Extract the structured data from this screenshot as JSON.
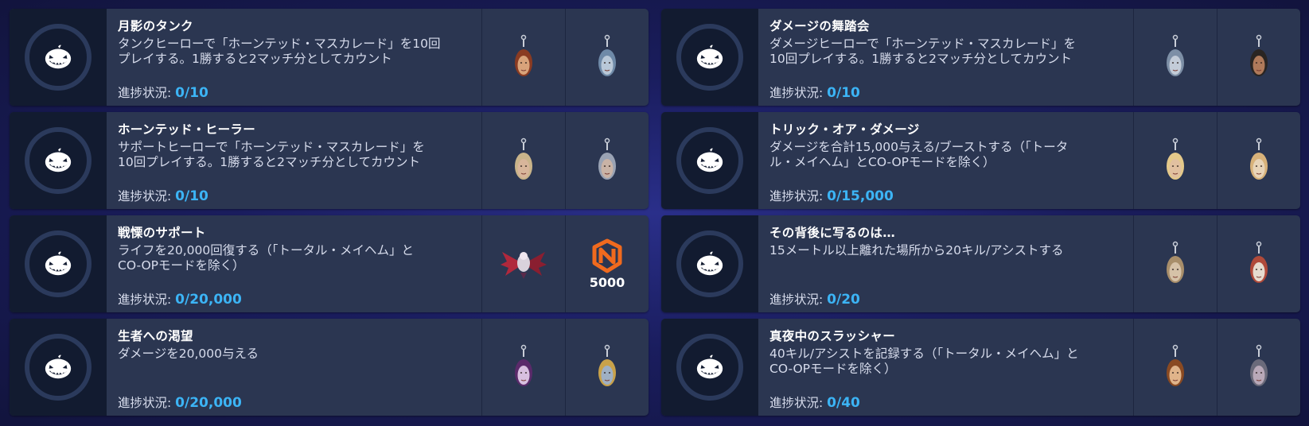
{
  "challenges": [
    {
      "title": "月影のタンク",
      "desc_lines": [
        "タンクヒーローで「ホーンテッド・マスカレード」を10回",
        "プレイする。1勝すると2マッチ分としてカウント"
      ],
      "progress_label": "進捗状況:",
      "current": "0",
      "total": "10",
      "rewards": [
        {
          "type": "charm",
          "icon": "charm-icon",
          "hair": "#8a3b22",
          "face": "#d9a37a"
        },
        {
          "type": "charm",
          "icon": "charm-icon",
          "hair": "#6f8aa8",
          "face": "#b9c8d8"
        }
      ]
    },
    {
      "title": "ダメージの舞踏会",
      "desc_lines": [
        "ダメージヒーローで「ホーンテッド・マスカレード」を",
        "10回プレイする。1勝すると2マッチ分としてカウント"
      ],
      "progress_label": "進捗状況:",
      "current": "0",
      "total": "10",
      "rewards": [
        {
          "type": "charm",
          "icon": "charm-icon",
          "hair": "#7d8fa6",
          "face": "#c3ccd8"
        },
        {
          "type": "charm",
          "icon": "charm-icon",
          "hair": "#2a2522",
          "face": "#b07a5a"
        }
      ]
    },
    {
      "title": "ホーンテッド・ヒーラー",
      "desc_lines": [
        "サポートヒーローで「ホーンテッド・マスカレード」を",
        "10回プレイする。1勝すると2マッチ分としてカウント"
      ],
      "progress_label": "進捗状況:",
      "current": "0",
      "total": "10",
      "rewards": [
        {
          "type": "charm",
          "icon": "charm-icon",
          "hair": "#c9b48a",
          "face": "#d8b59a"
        },
        {
          "type": "charm",
          "icon": "charm-icon",
          "hair": "#9aa3b4",
          "face": "#c9b3a6"
        }
      ]
    },
    {
      "title": "トリック・オア・ダメージ",
      "desc_lines": [
        "ダメージを合計15,000与える/ブーストする（「トータ",
        "ル・メイヘム」とCO-OPモードを除く）"
      ],
      "progress_label": "進捗状況:",
      "current": "0",
      "total": "15,000",
      "rewards": [
        {
          "type": "charm",
          "icon": "charm-icon",
          "hair": "#e4c98a",
          "face": "#e1c0a0"
        },
        {
          "type": "charm",
          "icon": "charm-icon",
          "hair": "#d8b27a",
          "face": "#e8d4b8"
        }
      ]
    },
    {
      "title": "戦慄のサポート",
      "desc_lines": [
        "ライフを20,000回復する（「トータル・メイヘム」と",
        "CO-OPモードを除く）"
      ],
      "progress_label": "進捗状況:",
      "current": "0",
      "total": "20,000",
      "rewards": [
        {
          "type": "spray",
          "icon": "winged-spray-icon"
        },
        {
          "type": "currency",
          "icon": "currency-badge-icon",
          "value": "5000",
          "color": "#f06a1e"
        }
      ]
    },
    {
      "title": "その背後に写るのは…",
      "desc_lines": [
        "15メートル以上離れた場所から20キル/アシストする"
      ],
      "progress_label": "進捗状況:",
      "current": "0",
      "total": "20",
      "rewards": [
        {
          "type": "charm",
          "icon": "charm-icon",
          "hair": "#a88e6a",
          "face": "#d6c2a8"
        },
        {
          "type": "charm",
          "icon": "charm-icon",
          "hair": "#b04a3a",
          "face": "#e6dccf"
        }
      ]
    },
    {
      "title": "生者への渇望",
      "desc_lines": [
        "ダメージを20,000与える"
      ],
      "progress_label": "進捗状況:",
      "current": "0",
      "total": "20,000",
      "rewards": [
        {
          "type": "charm",
          "icon": "charm-icon",
          "hair": "#5a2a6a",
          "face": "#d8c0e0"
        },
        {
          "type": "charm",
          "icon": "charm-icon",
          "hair": "#c9a24a",
          "face": "#9fb0c4"
        }
      ]
    },
    {
      "title": "真夜中のスラッシャー",
      "desc_lines": [
        "40キル/アシストを記録する（「トータル・メイヘム」と",
        "CO-OPモードを除く）"
      ],
      "progress_label": "進捗状況:",
      "current": "0",
      "total": "40",
      "rewards": [
        {
          "type": "charm",
          "icon": "charm-icon",
          "hair": "#8a4a22",
          "face": "#e0b48a"
        },
        {
          "type": "charm",
          "icon": "charm-icon",
          "hair": "#6a6a7a",
          "face": "#b8a8b8"
        }
      ]
    }
  ],
  "colors": {
    "progress": "#3cb4f5",
    "card": "#2b3651",
    "icon_panel": "#121b30"
  },
  "challenge_icon": "jack-o-lantern-icon"
}
